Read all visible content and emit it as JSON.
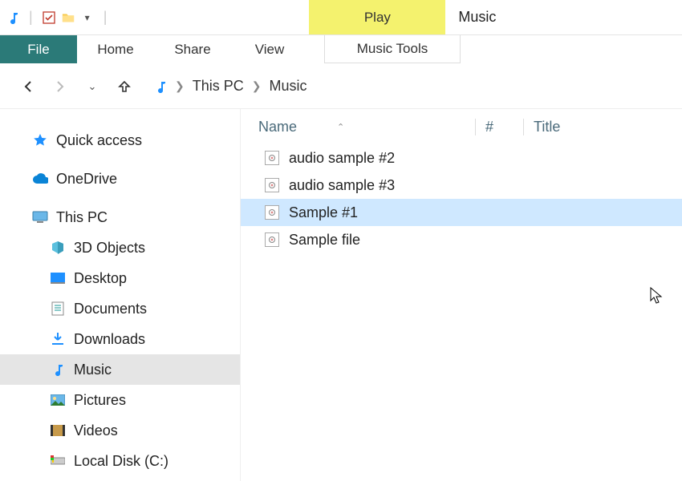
{
  "titlebar": {
    "play_label": "Play",
    "window_title": "Music"
  },
  "ribbon": {
    "file": "File",
    "home": "Home",
    "share": "Share",
    "view": "View",
    "tools": "Music Tools"
  },
  "breadcrumb": {
    "seg1": "This PC",
    "seg2": "Music"
  },
  "columns": {
    "name": "Name",
    "num": "#",
    "title": "Title"
  },
  "sidebar": {
    "quick_access": "Quick access",
    "onedrive": "OneDrive",
    "this_pc": "This PC",
    "items": [
      {
        "label": "3D Objects"
      },
      {
        "label": "Desktop"
      },
      {
        "label": "Documents"
      },
      {
        "label": "Downloads"
      },
      {
        "label": "Music"
      },
      {
        "label": "Pictures"
      },
      {
        "label": "Videos"
      },
      {
        "label": "Local Disk (C:)"
      }
    ]
  },
  "files": [
    {
      "name": "audio sample #2"
    },
    {
      "name": "audio sample #3"
    },
    {
      "name": "Sample #1"
    },
    {
      "name": "Sample file"
    }
  ],
  "selected_file_index": 2
}
